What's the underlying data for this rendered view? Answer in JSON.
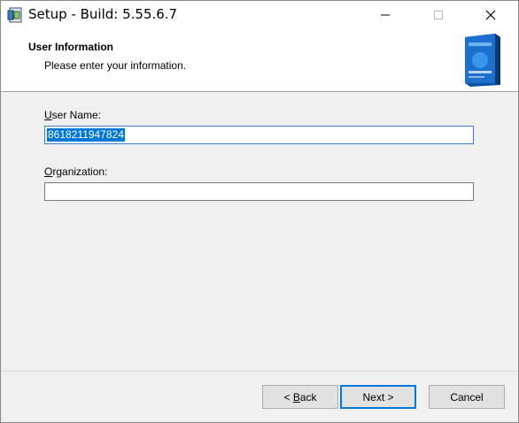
{
  "window": {
    "title": "Setup - Build: 5.55.6.7"
  },
  "header": {
    "title": "User Information",
    "subtitle": "Please enter your information."
  },
  "form": {
    "user_name_label_prefix": "",
    "user_name_label_accel": "U",
    "user_name_label_rest": "ser Name:",
    "user_name_value": "8618211947824",
    "organization_label_accel": "O",
    "organization_label_rest": "rganization:",
    "organization_value": ""
  },
  "buttons": {
    "back_prefix": "< ",
    "back_accel": "B",
    "back_rest": "ack",
    "next": "Next >",
    "cancel": "Cancel"
  },
  "colors": {
    "selection": "#0078d7",
    "focus_border": "#3b7bd4"
  },
  "icons": [
    "setup-app-icon",
    "minimize-icon",
    "maximize-icon",
    "close-icon",
    "product-box-image"
  ]
}
